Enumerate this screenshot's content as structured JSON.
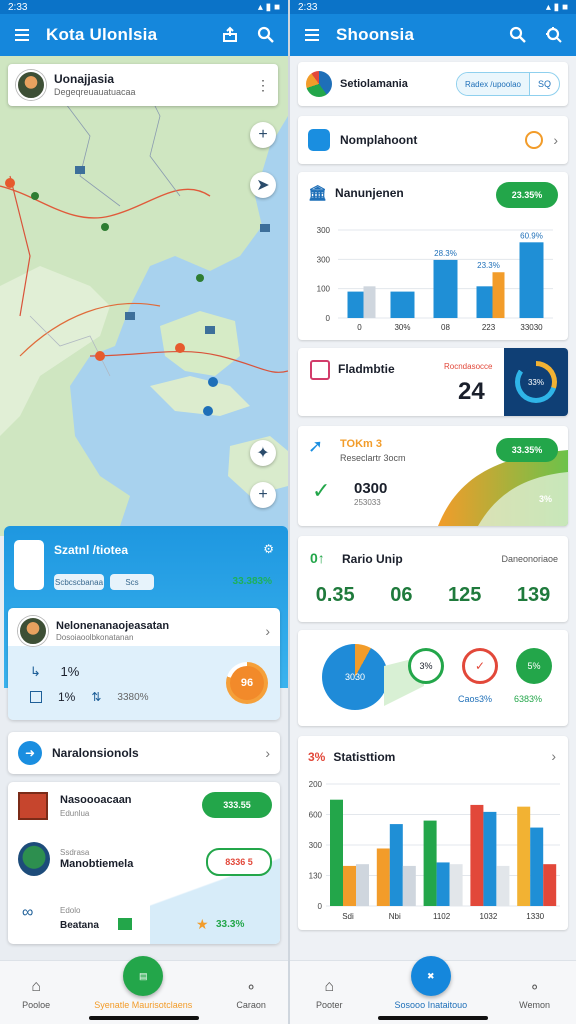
{
  "status": {
    "time": "2:33",
    "right": "▴ ▮ ■"
  },
  "left": {
    "appbar": {
      "title": "Kota Ulonlsia"
    },
    "map_card": {
      "title": "Uonajjasia",
      "subtitle": "Degeqreuauatuacaa"
    },
    "blue_panel": {
      "title": "Szatnl /tiotea",
      "chip1": "Scbcscbanaa",
      "chip2": "Scs",
      "pct": "33.383%"
    },
    "project_card": {
      "title": "Nelonenanaojeasatan",
      "subtitle": "Dosoiaoolbkonatanan",
      "stat1": "1%",
      "stat2": "1%",
      "stat3": "3380%",
      "donut": "96"
    },
    "list_card": {
      "title": "Naralonsionols"
    },
    "detail_card": {
      "row1_title": "Nasoooacaan",
      "row1_sub": "Edunlua",
      "row1_badge": "333.55",
      "row2_title": "Manobtiemela",
      "row2_sub": "Ssdrasa",
      "row2_badge": "8336 5",
      "row3_top": "Edolo",
      "row3_title": "Beatana",
      "row3_pct": "33.3%"
    },
    "nav": {
      "item1": "Pooloe",
      "item2": "Syenatle Maurisotclaens",
      "item3": "Caraon"
    }
  },
  "right": {
    "appbar": {
      "title": "Shoonsia"
    },
    "card1": {
      "title": "Setiolamania",
      "chip1": "Radex /upoolao",
      "chip2": "SQ"
    },
    "card2": {
      "title": "Nomplahoont"
    },
    "card3": {
      "title": "Nanunjenen",
      "badge": "23.35%",
      "bar_top1": "28.3%",
      "bar_top2": "23.3%",
      "bar_top3": "60.9%"
    },
    "card4": {
      "title": "Fladmbtie",
      "subtitle": "Rocndasocce",
      "value": "24",
      "gauge": "33%"
    },
    "card5": {
      "title": "TOKm 3",
      "subtitle": "Reseclartr 3ocm",
      "value": "0300",
      "sub_value": "253033",
      "badge": "33.35%",
      "small_pct": "3%"
    },
    "card6": {
      "title": "Rario Unip",
      "subtitle": "Daneonoriaoe",
      "v1": "0.35",
      "v2": "06",
      "v3": "125",
      "v4": "139"
    },
    "card7": {
      "pie_label": "3030",
      "ring_label": "3%",
      "c1_label": "Caos3%",
      "c2_label": "6383%",
      "c2_inner": "5%"
    },
    "card8": {
      "prefix": "3%",
      "title": "Statisttiom"
    },
    "nav": {
      "item1": "Pooter",
      "item2": "Sosooo Inataitouo",
      "item3": "Wemon"
    }
  },
  "colors": {
    "blue": "#1587dc",
    "green": "#23a64a",
    "orange": "#f29c2a",
    "red": "#e2483a",
    "teal": "#1aa0d8"
  },
  "chart_data": [
    {
      "type": "bar",
      "categories": [
        "0",
        "30%",
        "08",
        "223",
        "33030"
      ],
      "series": [
        {
          "values": [
            150,
            150,
            330,
            180,
            430
          ]
        },
        {
          "values": [
            180,
            0,
            0,
            260,
            0
          ]
        }
      ],
      "ylim": [
        0,
        500
      ],
      "yticks": [
        "0",
        "100",
        "300",
        "300"
      ]
    },
    {
      "type": "bar",
      "categories": [
        "Sdi",
        "Nbi",
        "1102",
        "1032",
        "1330"
      ],
      "series": [
        {
          "values": [
            610,
            330,
            490,
            580,
            570
          ]
        },
        {
          "values": [
            230,
            470,
            250,
            540,
            450
          ]
        },
        {
          "values": [
            240,
            230,
            240,
            230,
            240
          ]
        }
      ],
      "ylim": [
        0,
        700
      ],
      "yticks": [
        "200",
        "600",
        "300",
        "130",
        "0"
      ]
    }
  ]
}
